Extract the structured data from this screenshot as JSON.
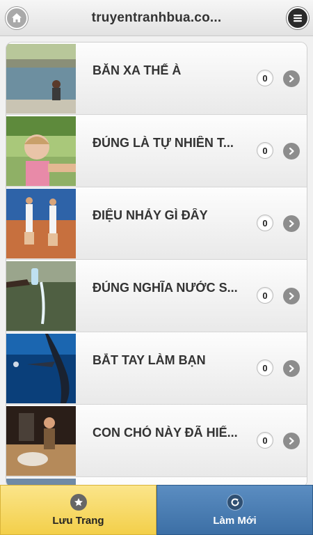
{
  "header": {
    "title": "truyentranhbua.co...",
    "home_icon": "home-icon",
    "menu_icon": "menu-icon"
  },
  "list": {
    "items": [
      {
        "label": "BĂN XA THẾ À",
        "count": "0",
        "thumb": "thumb-pool"
      },
      {
        "label": "ĐÚNG LÀ TỰ NHIÊN T...",
        "count": "0",
        "thumb": "thumb-girl"
      },
      {
        "label": "ĐIỆU NHẢY GÌ ĐÂY",
        "count": "0",
        "thumb": "thumb-tennis"
      },
      {
        "label": "ĐÚNG NGHĨA NƯỚC S...",
        "count": "0",
        "thumb": "thumb-water"
      },
      {
        "label": "BẮT TAY LÀM BẠN",
        "count": "0",
        "thumb": "thumb-whale"
      },
      {
        "label": "CON CHÓ NÀY ĐÃ HIỂ...",
        "count": "0",
        "thumb": "thumb-dog"
      }
    ]
  },
  "footer": {
    "save_label": "Lưu Trang",
    "refresh_label": "Làm Mới",
    "save_icon": "star-icon",
    "refresh_icon": "refresh-icon"
  },
  "colors": {
    "save_bg": "#f3cf4a",
    "refresh_bg": "#3c6fa5",
    "arrow": "#8d8d8d"
  }
}
